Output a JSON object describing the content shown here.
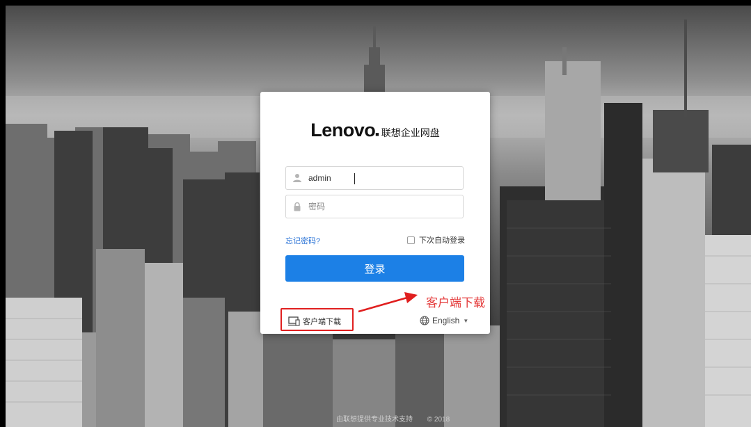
{
  "brand": {
    "logo": "Lenovo",
    "name": "联想企业网盘"
  },
  "login": {
    "username_value": "admin",
    "password_placeholder": "密码",
    "forgot_label": "忘记密码?",
    "remember_label": "下次自动登录",
    "submit_label": "登录"
  },
  "footer_links": {
    "client_download_label": "客户端下载",
    "language_label": "English"
  },
  "annotation": {
    "label": "客户端下载",
    "color": "#e01f1f"
  },
  "page_footer": {
    "support_text": "由联想提供专业技术支持",
    "copyright": "© 2018"
  },
  "colors": {
    "accent": "#1c80e6",
    "link": "#2a73d6"
  },
  "icons": [
    "user-icon",
    "lock-icon",
    "checkbox",
    "client-download-icon",
    "globe-icon",
    "caret-down-icon",
    "arrow-icon"
  ]
}
